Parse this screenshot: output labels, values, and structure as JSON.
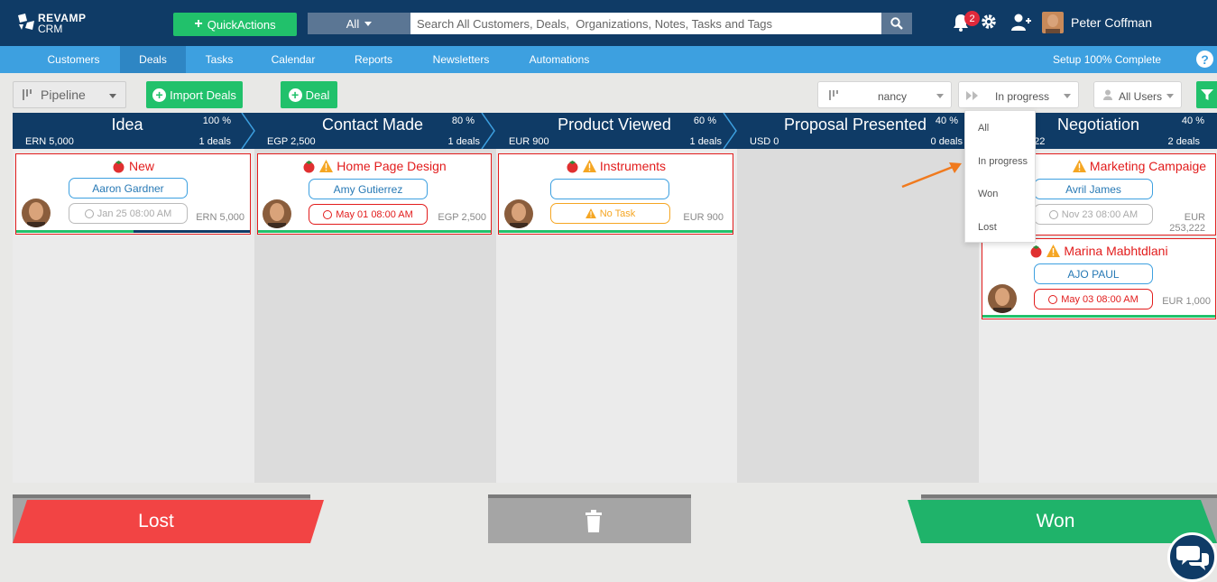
{
  "app": {
    "logo_line1": "REVAMP",
    "logo_line2": "CRM"
  },
  "header": {
    "quick_actions": "QuickActions",
    "search_scope": "All",
    "search_placeholder": "Search All Customers, Deals,  Organizations, Notes, Tasks and Tags",
    "notifications_count": "2",
    "user_name": "Peter Coffman"
  },
  "nav": {
    "items": [
      "Customers",
      "Deals",
      "Tasks",
      "Calendar",
      "Reports",
      "Newsletters",
      "Automations"
    ],
    "active": "Deals",
    "setup": "Setup 100% Complete",
    "help": "?"
  },
  "toolbar": {
    "view": "Pipeline",
    "import_label": "Import Deals",
    "deal_label": "Deal",
    "pipeline_filter": "nancy",
    "status_filter": "In progress",
    "user_filter": "All Users"
  },
  "stages": [
    {
      "name": "Idea",
      "percent": "100 %",
      "amount": "ERN 5,000",
      "deals": "1 deals"
    },
    {
      "name": "Contact Made",
      "percent": "80 %",
      "amount": "EGP 2,500",
      "deals": "1 deals"
    },
    {
      "name": "Product Viewed",
      "percent": "60 %",
      "amount": "EUR 900",
      "deals": "1 deals"
    },
    {
      "name": "Proposal Presented",
      "percent": "40 %",
      "amount": "USD 0",
      "deals": "0 deals"
    },
    {
      "name": "Negotiation",
      "percent": "40 %",
      "amount": "222",
      "deals": "2 deals"
    }
  ],
  "cards": [
    {
      "title": "New",
      "contact": "Aaron Gardner",
      "date": "Jan 25 08:00 AM",
      "amount": "ERN 5,000",
      "progress": 0.5
    },
    {
      "title": "Home Page Design",
      "contact": "Amy Gutierrez",
      "date": "May 01 08:00 AM",
      "amount": "EGP 2,500",
      "progress": 1.0
    },
    {
      "title": "Instruments",
      "contact": "",
      "date": "No Task",
      "amount": "EUR 900",
      "progress": 1.0
    },
    {
      "title": "Marketing Campaige",
      "contact": "Avril James",
      "date": "Nov 23 08:00 AM",
      "amount_line1": "EUR",
      "amount_line2": "253,222",
      "progress": 1.0
    },
    {
      "title": "Marina Mabhtdlani",
      "contact": "AJO PAUL",
      "date": "May 03 08:00 AM",
      "amount": "EUR 1,000",
      "progress": 1.0
    }
  ],
  "status_dropdown": {
    "options": [
      "All",
      "In progress",
      "Won",
      "Lost"
    ]
  },
  "bottom": {
    "lost": "Lost",
    "won": "Won"
  },
  "colors": {
    "header": "#0f3b66",
    "nav": "#3da0e0",
    "green": "#21c16b",
    "red": "#f24444",
    "warn": "#f5a623"
  }
}
